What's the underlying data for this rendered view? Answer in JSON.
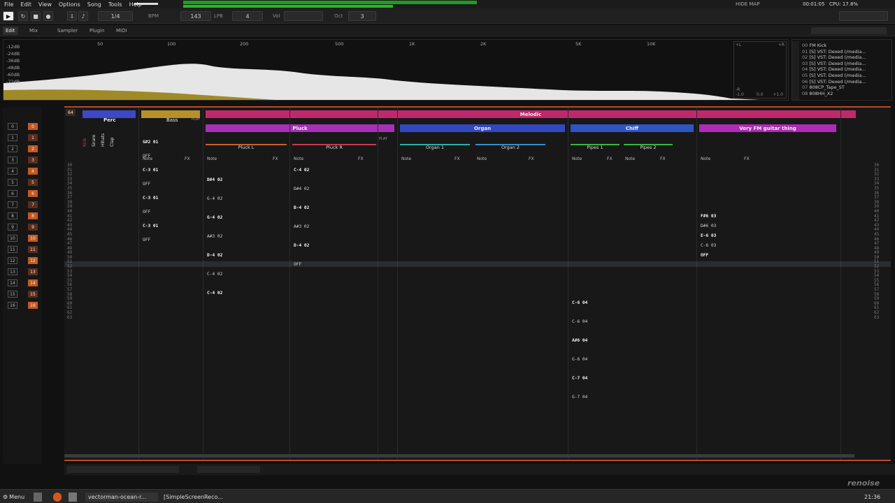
{
  "menu": [
    "File",
    "Edit",
    "View",
    "Options",
    "Song",
    "Tools",
    "Help"
  ],
  "toolbar": {
    "step": "1/4",
    "bpm_label": "BPM",
    "bpm": "143",
    "lpb_label": "LPB",
    "lpb": "4",
    "vol_label": "Vol",
    "oct_label": "Oct",
    "oct": "3",
    "time": "00:01:05",
    "cpu": "CPU: 17.8%",
    "status": "HIDE MAP"
  },
  "tabs": [
    "Edit",
    "Mix",
    "Sampler",
    "Plugin",
    "MIDI"
  ],
  "spectrum": {
    "db_labels": [
      "-12dB",
      "-24dB",
      "-36dB",
      "-48dB",
      "-60dB",
      "-72dB"
    ],
    "freq_labels": [
      "50",
      "100",
      "200",
      "500",
      "1K",
      "2K",
      "5K",
      "10K"
    ],
    "scope_labels": [
      "-1.0",
      "0.0",
      "+1.0",
      "+L",
      "+R",
      "-R"
    ],
    "white_fill": "#e6e6e6",
    "gold_fill": "#a08a28"
  },
  "instruments": [
    {
      "num": "00",
      "name": "FM Kick"
    },
    {
      "num": "01",
      "name": "[S] VST: Dexed (/media..."
    },
    {
      "num": "02",
      "name": "[S] VST: Dexed (/media..."
    },
    {
      "num": "03",
      "name": "[S] VST: Dexed (/media..."
    },
    {
      "num": "04",
      "name": "[S] VST: Dexed (/media..."
    },
    {
      "num": "05",
      "name": "[S] VST: Dexed (/media..."
    },
    {
      "num": "06",
      "name": "[S] VST: Dexed (/media..."
    },
    {
      "num": "07",
      "name": "808CP_Tape_ST"
    },
    {
      "num": "08",
      "name": "808HH_X2"
    }
  ],
  "sequencer": {
    "patterns": [
      "0",
      "1",
      "2",
      "3",
      "4",
      "5",
      "6",
      "7",
      "8",
      "9",
      "10",
      "11",
      "12",
      "13",
      "14",
      "15",
      "16"
    ],
    "slots": [
      "0",
      "1",
      "2",
      "3",
      "4",
      "5",
      "6",
      "7",
      "8",
      "9",
      "10",
      "11",
      "12",
      "13",
      "14",
      "15",
      "16"
    ]
  },
  "pattern_editor": {
    "lines": "64",
    "groups": [
      {
        "name": "Perc",
        "color": "#3c48c8"
      },
      {
        "name": "Bass",
        "color": "#b8902a"
      },
      {
        "name": "Melodic",
        "color": "#c0286c"
      },
      {
        "name": "Pluck",
        "color": "#a830b8"
      },
      {
        "name": "Organ",
        "color": "#3248c0"
      },
      {
        "name": "Chiff",
        "color": "#2f54c4"
      },
      {
        "name": "Very FM guitar thing",
        "color": "#b02ab8"
      }
    ],
    "tracks": [
      "Kick",
      "Snare",
      "Hihats",
      "Clap",
      "Pluck L",
      "Pluck R",
      "Organ 1",
      "Organ 2",
      "Pipes 1",
      "Pipes 2"
    ],
    "col_note": "Note",
    "col_fx": "FX",
    "play": "PLAY",
    "row_numbers": [
      "30",
      "31",
      "32",
      "33",
      "34",
      "35",
      "36",
      "37",
      "38",
      "39",
      "40",
      "41",
      "42",
      "43",
      "44",
      "45",
      "46",
      "47",
      "48",
      "49",
      "50",
      "51",
      "52",
      "53",
      "54",
      "55",
      "56",
      "57",
      "58",
      "59",
      "60",
      "61",
      "62",
      "63"
    ],
    "bass_cells": [
      "G#2 01",
      "OFF",
      "C-3 01",
      "OFF",
      "C-3 01",
      "OFF",
      "C-3 01",
      "OFF"
    ],
    "pluckl_cells": [
      "D#4 02",
      "G-4 02",
      "G-4 02",
      "A#3 02",
      "D-4 02",
      "C-4 02",
      "C-4 02"
    ],
    "pluckr_cells": [
      "C-4 02",
      "D#4 02",
      "B-4 02",
      "A#3 02",
      "D-4 02",
      "OFF"
    ],
    "guitar_cells": [
      "F#6 03",
      "D#6 03",
      "E-6 03",
      "C-6 03",
      "OFF"
    ],
    "pipes_cells": [
      "C-6 04",
      "C-6 04",
      "A#6 04",
      "G-6 04",
      "C-7 04",
      "G-7 04"
    ]
  },
  "taskbar": {
    "menu": "Menu",
    "apps": [
      "vectorman-ocean-r...",
      "[SimpleScreenReco..."
    ],
    "clock": "21:36",
    "brand": "renoise"
  }
}
